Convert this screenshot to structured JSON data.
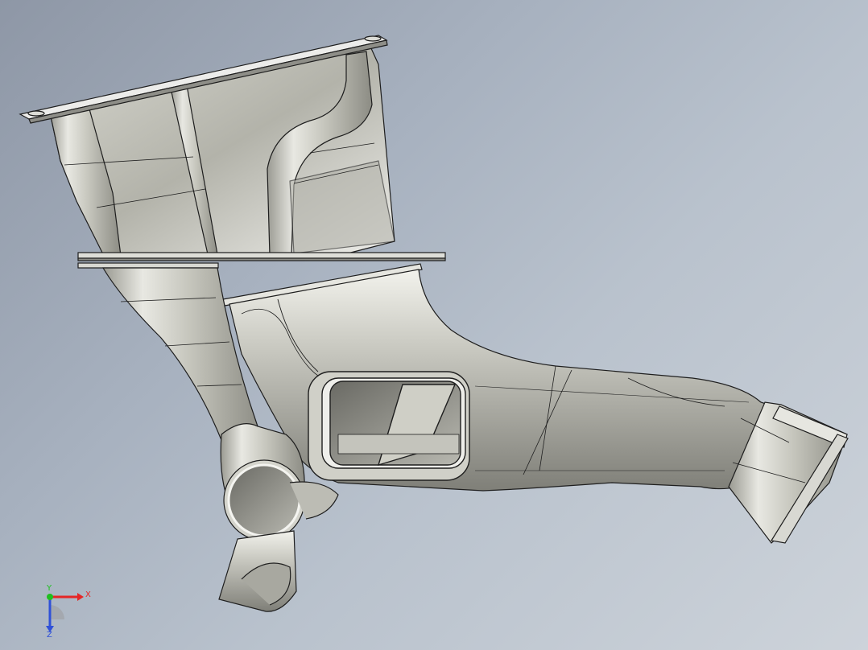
{
  "viewport": {
    "model_name": "",
    "background_top": "#8e97a6",
    "background_bottom": "#cdd3da",
    "part_color": "#c8c8c0",
    "edge_color": "#1e1e1e"
  },
  "triad": {
    "x_label": "X",
    "y_label": "Y",
    "z_label": "Z",
    "x_color": "#e52626",
    "y_color": "#1fbf1f",
    "z_color": "#2f50d8"
  }
}
